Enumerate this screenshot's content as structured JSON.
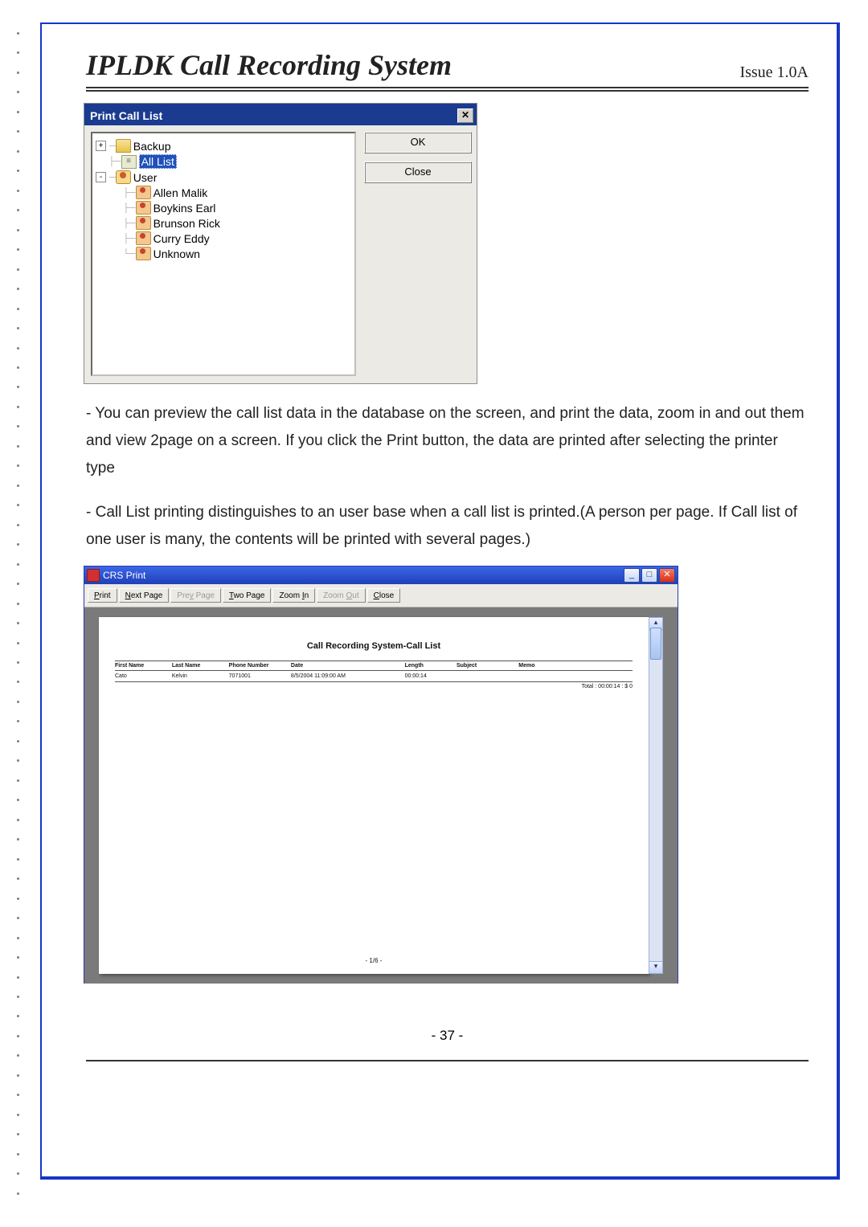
{
  "header": {
    "title": "IPLDK Call Recording System",
    "issue": "Issue 1.0A"
  },
  "dialog1": {
    "title": "Print Call List",
    "ok_label": "OK",
    "close_label": "Close",
    "tree": {
      "backup": "Backup",
      "all_list": "All List",
      "user": "User",
      "users": [
        "Allen Malik",
        "Boykins Earl",
        "Brunson Rick",
        "Curry Eddy",
        "Unknown"
      ]
    }
  },
  "para1": "- You can preview the call list data in the database on the screen, and print the data, zoom in and out them and view 2page on a screen. If you click the Print button, the data are printed after selecting the printer type",
  "para2": "- Call List printing distinguishes to an user base when a call list is printed.(A person per page. If Call list of one user is many, the contents will be printed with several pages.)",
  "crs": {
    "app_title": "CRS Print",
    "toolbar": {
      "print": "Print",
      "next": "Next Page",
      "prev": "Prev Page",
      "two": "Two Page",
      "zin": "Zoom In",
      "zout": "Zoom Out",
      "close": "Close"
    },
    "report_title": "Call Recording System-Call List",
    "columns": {
      "first": "First Name",
      "last": "Last Name",
      "phone": "Phone Number",
      "date": "Date",
      "length": "Length",
      "subject": "Subject",
      "memo": "Memo"
    },
    "row": {
      "first": "Cato",
      "last": "Kelvin",
      "phone": "7071001",
      "date": "8/5/2004 11:09:00 AM",
      "length": "00:00:14",
      "subject": "",
      "memo": ""
    },
    "total": "Total : 00:00:14  : $ 0",
    "page_footer": "- 1/6 -"
  },
  "page_number": "- 37 -"
}
